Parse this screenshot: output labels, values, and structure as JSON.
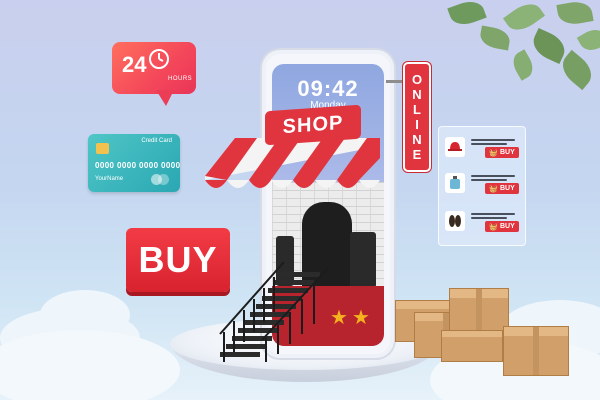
{
  "phone": {
    "time": "09:42",
    "day": "Monday"
  },
  "shop_sign": {
    "label": "SHOP"
  },
  "online_sign": {
    "letters": [
      "O",
      "N",
      "L",
      "I",
      "N",
      "E"
    ]
  },
  "hours_badge": {
    "number": "24",
    "unit": "HOURS"
  },
  "credit_card": {
    "label": "Credit Card",
    "number": "0000 0000 0000 0000",
    "name": "YourName"
  },
  "buy_sign": {
    "label": "BUY"
  },
  "product_panel": {
    "items": [
      {
        "icon": "cap-icon",
        "buy_label": "BUY"
      },
      {
        "icon": "perfume-icon",
        "buy_label": "BUY"
      },
      {
        "icon": "sandals-icon",
        "buy_label": "BUY"
      }
    ]
  },
  "colors": {
    "accent_red": "#e0343e",
    "badge_gradient": "#f4475a",
    "card_teal": "#2aa7b3",
    "box_brown": "#d1a06a",
    "background": "#c9cfee"
  }
}
